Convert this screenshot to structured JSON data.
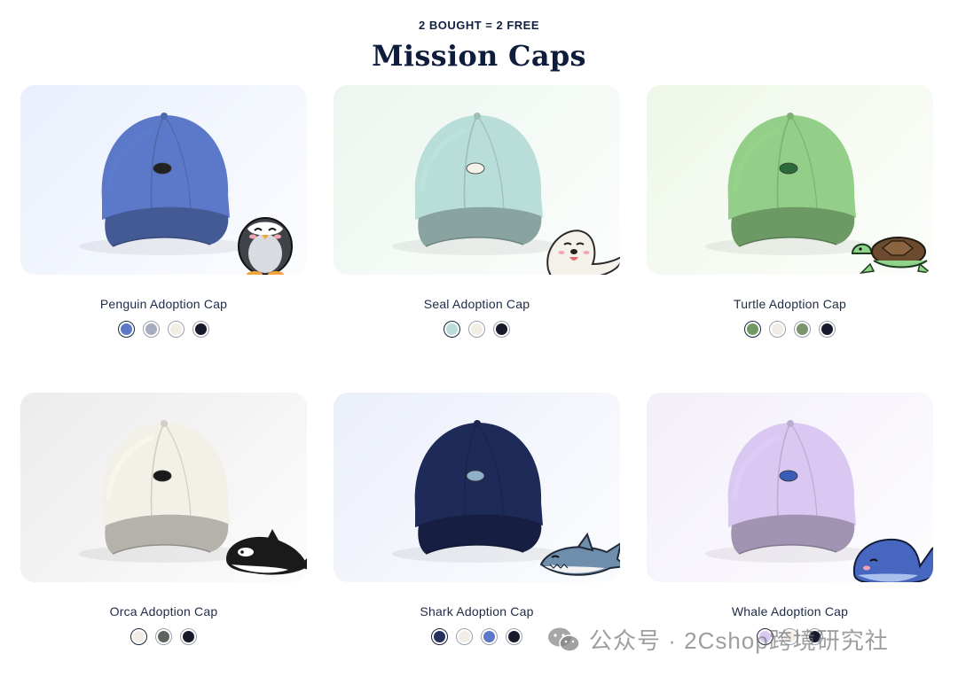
{
  "header": {
    "promo": "2 BOUGHT = 2 FREE",
    "title": "Mission Caps"
  },
  "products": [
    {
      "name": "Penguin Adoption Cap",
      "cap_color": "#5b79c8",
      "bg_color": "#e9effc",
      "mascot": "penguin-icon",
      "swatches": [
        "#5b79c8",
        "#a7adbd",
        "#f1ede4",
        "#161a2a"
      ]
    },
    {
      "name": "Seal Adoption Cap",
      "cap_color": "#b9ddd8",
      "bg_color": "#ecf6ef",
      "mascot": "seal-icon",
      "swatches": [
        "#b9ddd8",
        "#f1ede4",
        "#161a2a"
      ]
    },
    {
      "name": "Turtle Adoption Cap",
      "cap_color": "#93cf88",
      "bg_color": "#eef7e8",
      "mascot": "turtle-icon",
      "swatches": [
        "#6f9a63",
        "#f1ede4",
        "#7a9470",
        "#161a2a"
      ]
    },
    {
      "name": "Orca Adoption Cap",
      "cap_color": "#f3f0e7",
      "bg_color": "#ececec",
      "mascot": "orca-icon",
      "swatches": [
        "#f1ede4",
        "#5d6460",
        "#161a2a"
      ]
    },
    {
      "name": "Shark Adoption Cap",
      "cap_color": "#1e2a58",
      "bg_color": "#ebeffa",
      "mascot": "shark-icon",
      "swatches": [
        "#24315f",
        "#f1ede4",
        "#5b79c8",
        "#161a2a"
      ]
    },
    {
      "name": "Whale Adoption Cap",
      "cap_color": "#dac8f2",
      "bg_color": "#f3effa",
      "mascot": "whale-icon",
      "swatches": [
        "#d9c8f0",
        "#f1ede4",
        "#161a2a"
      ]
    }
  ],
  "watermark": {
    "text": "公众号 · 2Cshop跨境研究社"
  }
}
